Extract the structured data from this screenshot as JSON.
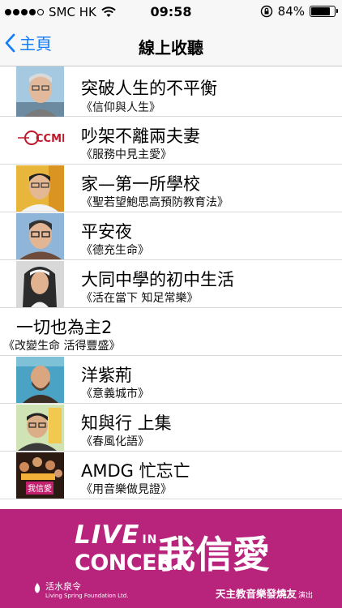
{
  "status": {
    "carrier": "SMC HK",
    "time": "09:58",
    "battery": "84%",
    "battery_level": 0.84
  },
  "nav": {
    "back_label": "主頁",
    "title": "線上收聽"
  },
  "list": [
    {
      "title": "突破人生的不平衡",
      "subtitle": "《信仰與人生》",
      "thumb": "portrait-elderly-man"
    },
    {
      "title": "吵架不離兩夫妻",
      "subtitle": "《服務中見主愛》",
      "thumb": "ccmf-logo",
      "logo_text": "CCMF"
    },
    {
      "title": "家—第一所學校",
      "subtitle": "《聖若望鮑思高預防教育法》",
      "thumb": "portrait-man-glasses"
    },
    {
      "title": "平安夜",
      "subtitle": "《德充生命》",
      "thumb": "portrait-man-glasses-2"
    },
    {
      "title": "大同中學的初中生活",
      "subtitle": "《活在當下 知足常樂》",
      "thumb": "portrait-nun"
    },
    {
      "title": "一切也為主2",
      "subtitle": "《改變生命 活得豐盛》",
      "thumb": ""
    },
    {
      "title": "洋紫荊",
      "subtitle": "《意義城市》",
      "thumb": "portrait-bearded-man"
    },
    {
      "title": "知與行 上集",
      "subtitle": "《春風化語》",
      "thumb": "portrait-man-poster"
    },
    {
      "title": "AMDG 忙忘亡",
      "subtitle": "《用音樂做見證》",
      "thumb": "concert-poster",
      "poster_text": "我信愛"
    }
  ],
  "banner": {
    "live": "LIVE",
    "in": "IN",
    "concert": "CONCERT",
    "headline": "我信愛",
    "org_cn": "活水泉令",
    "org_en": "Living Spring Foundation Ltd.",
    "presenter": "天主教音樂發燒友",
    "presenter_suffix": "演出"
  },
  "colors": {
    "accent": "#157efb",
    "banner": "#b8237c"
  }
}
